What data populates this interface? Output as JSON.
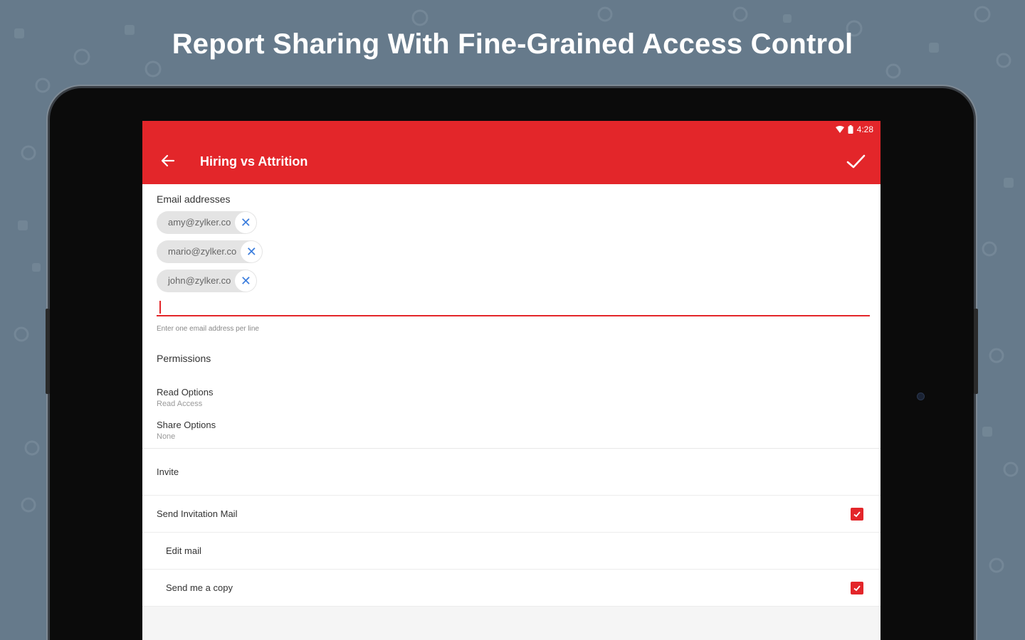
{
  "headline": "Report Sharing With Fine-Grained Access Control",
  "status_bar": {
    "time": "4:28"
  },
  "app_bar": {
    "title": "Hiring vs Attrition"
  },
  "email_section": {
    "label": "Email addresses",
    "chips": [
      "amy@zylker.co",
      "mario@zylker.co",
      "john@zylker.co"
    ],
    "input_value": "",
    "hint": "Enter one email address per line"
  },
  "permissions": {
    "label": "Permissions",
    "options": [
      {
        "title": "Read Options",
        "value": "Read Access"
      },
      {
        "title": "Share Options",
        "value": "None"
      }
    ]
  },
  "invite": {
    "label": "Invite",
    "send_invitation": {
      "label": "Send Invitation Mail",
      "checked": true
    },
    "edit_mail": {
      "label": "Edit mail"
    },
    "send_copy": {
      "label": "Send me a copy",
      "checked": true
    }
  },
  "colors": {
    "accent": "#e3262a",
    "background": "#667a8b",
    "chip_x": "#3b7ddd"
  }
}
